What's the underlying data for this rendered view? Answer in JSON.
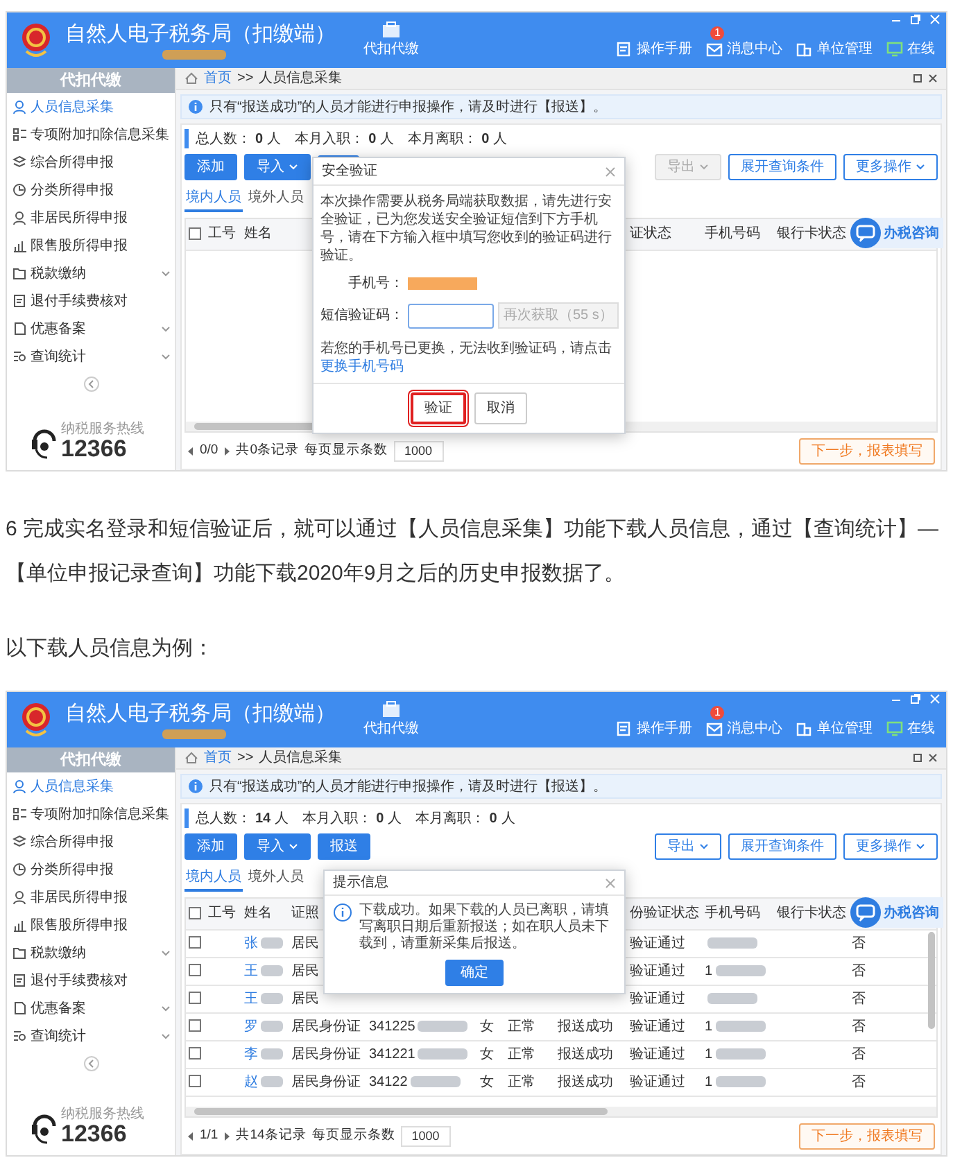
{
  "screens": [
    {
      "header": {
        "title": "自然人电子税务局（扣缴端）",
        "nav_tab": "代扣代缴",
        "links": [
          {
            "label": "操作手册"
          },
          {
            "label": "消息中心",
            "badge": "1"
          },
          {
            "label": "单位管理"
          },
          {
            "label": "在线"
          }
        ]
      },
      "sidebar": {
        "title": "代扣代缴",
        "items": [
          {
            "label": "人员信息采集",
            "selected": true,
            "expandable": false
          },
          {
            "label": "专项附加扣除信息采集",
            "selected": false,
            "expandable": false
          },
          {
            "label": "综合所得申报",
            "selected": false,
            "expandable": false
          },
          {
            "label": "分类所得申报",
            "selected": false,
            "expandable": false
          },
          {
            "label": "非居民所得申报",
            "selected": false,
            "expandable": false
          },
          {
            "label": "限售股所得申报",
            "selected": false,
            "expandable": false
          },
          {
            "label": "税款缴纳",
            "selected": false,
            "expandable": true
          },
          {
            "label": "退付手续费核对",
            "selected": false,
            "expandable": false
          },
          {
            "label": "优惠备案",
            "selected": false,
            "expandable": true
          },
          {
            "label": "查询统计",
            "selected": false,
            "expandable": true
          }
        ],
        "hotline": {
          "caption": "纳税服务热线",
          "number": "12366"
        }
      },
      "breadcrumb": {
        "items": [
          "首页",
          "人员信息采集"
        ],
        "separator": ">>"
      },
      "notice": "只有“报送成功”的人员才能进行申报操作，请及时进行【报送】。",
      "stats": [
        {
          "label": "总人数：",
          "value": "0",
          "unit": "人"
        },
        {
          "label": "本月入职：",
          "value": "0",
          "unit": "人"
        },
        {
          "label": "本月离职：",
          "value": "0",
          "unit": "人"
        }
      ],
      "toolbar_left": [
        {
          "kind": "primary",
          "label": "添加",
          "dropdown": false
        },
        {
          "kind": "primary",
          "label": "导入",
          "dropdown": true
        },
        {
          "kind": "primary"
        }
      ],
      "toolbar_right": [
        {
          "label": "导出",
          "dropdown": true,
          "disabled": true
        },
        {
          "label": "展开查询条件",
          "dropdown": false,
          "disabled": false
        },
        {
          "label": "更多操作",
          "dropdown": true,
          "disabled": false
        }
      ],
      "subtabs": [
        {
          "label": "境内人员",
          "selected": true
        },
        {
          "label": "境外人员",
          "selected": false
        }
      ],
      "all_checked": false,
      "columns": [
        "工号",
        "姓名",
        null,
        null,
        null,
        null,
        null,
        "证状态",
        "手机号码",
        "银行卡状态",
        null
      ],
      "chat_button": "办税咨询",
      "pager": {
        "pages": "0/0",
        "total": "共0条记录",
        "per_page_label": "每页显示条数",
        "per_page": "1000"
      },
      "next_button": "下一步，报表填写",
      "dialog": {
        "kind": "verify",
        "title": "安全验证",
        "message": "本次操作需要从税务局端获取数据，请先进行安全验证，已为您发送安全验证短信到下方手机号，请在下方输入框中填写您收到的验证码进行验证。",
        "phone_label": "手机号：",
        "code_label": "短信验证码：",
        "resend": "再次获取（55 s）",
        "note": "若您的手机号已更换，无法收到验证码，请点击",
        "link": "更换手机号码",
        "buttons": [
          {
            "label": "验证",
            "primary": false,
            "highlighted": true
          },
          {
            "label": "取消",
            "primary": false,
            "highlighted": false
          }
        ]
      }
    },
    {
      "header": {
        "title": "自然人电子税务局（扣缴端）",
        "nav_tab": "代扣代缴",
        "links": [
          {
            "label": "操作手册"
          },
          {
            "label": "消息中心",
            "badge": "1"
          },
          {
            "label": "单位管理"
          },
          {
            "label": "在线"
          }
        ]
      },
      "sidebar": {
        "title": "代扣代缴",
        "items": [
          {
            "label": "人员信息采集",
            "selected": true,
            "expandable": false
          },
          {
            "label": "专项附加扣除信息采集",
            "selected": false,
            "expandable": false
          },
          {
            "label": "综合所得申报",
            "selected": false,
            "expandable": false
          },
          {
            "label": "分类所得申报",
            "selected": false,
            "expandable": false
          },
          {
            "label": "非居民所得申报",
            "selected": false,
            "expandable": false
          },
          {
            "label": "限售股所得申报",
            "selected": false,
            "expandable": false
          },
          {
            "label": "税款缴纳",
            "selected": false,
            "expandable": true
          },
          {
            "label": "退付手续费核对",
            "selected": false,
            "expandable": false
          },
          {
            "label": "优惠备案",
            "selected": false,
            "expandable": true
          },
          {
            "label": "查询统计",
            "selected": false,
            "expandable": true
          }
        ],
        "hotline": {
          "caption": "纳税服务热线",
          "number": "12366"
        }
      },
      "breadcrumb": {
        "items": [
          "首页",
          "人员信息采集"
        ],
        "separator": ">>"
      },
      "notice": "只有“报送成功”的人员才能进行申报操作，请及时进行【报送】。",
      "stats": [
        {
          "label": "总人数：",
          "value": "14",
          "unit": "人"
        },
        {
          "label": "本月入职：",
          "value": "0",
          "unit": "人"
        },
        {
          "label": "本月离职：",
          "value": "0",
          "unit": "人"
        }
      ],
      "toolbar_left": [
        {
          "kind": "primary",
          "label": "添加",
          "dropdown": false
        },
        {
          "kind": "primary",
          "label": "导入",
          "dropdown": true
        },
        {
          "kind": "primary",
          "label": "报送",
          "dropdown": false
        }
      ],
      "toolbar_right": [
        {
          "label": "导出",
          "dropdown": true,
          "disabled": false
        },
        {
          "label": "展开查询条件",
          "dropdown": false,
          "disabled": false
        },
        {
          "label": "更多操作",
          "dropdown": true,
          "disabled": false
        }
      ],
      "subtabs": [
        {
          "label": "境内人员",
          "selected": true
        },
        {
          "label": "境外人员",
          "selected": false
        }
      ],
      "all_checked": false,
      "columns": [
        "工号",
        "姓名",
        "证照",
        null,
        null,
        null,
        null,
        "份验证状态",
        "手机号码",
        "银行卡状态",
        null
      ],
      "rows": [
        {
          "checked": false,
          "cells": [
            null,
            {
              "text": "张",
              "redacted": true
            },
            "居民",
            null,
            null,
            null,
            null,
            "验证通过",
            {
              "redacted": true
            },
            null,
            "否"
          ]
        },
        {
          "checked": false,
          "cells": [
            null,
            {
              "text": "王",
              "redacted": true
            },
            "居民",
            null,
            null,
            null,
            null,
            "验证通过",
            {
              "text": "1",
              "redacted": true
            },
            null,
            "否"
          ]
        },
        {
          "checked": false,
          "cells": [
            null,
            {
              "text": "王",
              "redacted": true
            },
            "居民",
            null,
            null,
            null,
            null,
            "验证通过",
            {
              "redacted": true
            },
            null,
            "否"
          ]
        },
        {
          "checked": false,
          "cells": [
            null,
            {
              "text": "罗",
              "redacted": true
            },
            "居民身份证",
            {
              "text": "341225",
              "redacted": true
            },
            "女",
            "正常",
            "报送成功",
            "验证通过",
            {
              "text": "1",
              "redacted": true
            },
            null,
            "否"
          ]
        },
        {
          "checked": false,
          "cells": [
            null,
            {
              "text": "李",
              "redacted": true
            },
            "居民身份证",
            {
              "text": "341221",
              "redacted": true
            },
            "女",
            "正常",
            "报送成功",
            "验证通过",
            {
              "text": "1",
              "redacted": true
            },
            null,
            "否"
          ]
        },
        {
          "checked": false,
          "cells": [
            null,
            {
              "text": "赵",
              "redacted": true
            },
            "居民身份证",
            {
              "text": "34122",
              "redacted": true
            },
            "女",
            "正常",
            "报送成功",
            "验证通过",
            {
              "text": "1",
              "redacted": true
            },
            null,
            "否"
          ]
        }
      ],
      "chat_button": "办税咨询",
      "pager": {
        "pages": "1/1",
        "total": "共14条记录",
        "per_page_label": "每页显示条数",
        "per_page": "1000"
      },
      "next_button": "下一步，报表填写",
      "dialog": {
        "kind": "info",
        "title": "提示信息",
        "message": "下载成功。如果下载的人员已离职，请填写离职日期后重新报送；如在职人员未下载到，请重新采集后报送。",
        "buttons": [
          {
            "label": "确定",
            "primary": true,
            "highlighted": false
          }
        ]
      }
    }
  ],
  "article": {
    "paragraphs": [
      "6 完成实名登录和短信验证后，就可以通过【人员信息采集】功能下载人员信息，通过【查询统计】—【单位申报记录查询】功能下载2020年9月之后的历史申报数据了。",
      "以下载人员信息为例："
    ]
  }
}
